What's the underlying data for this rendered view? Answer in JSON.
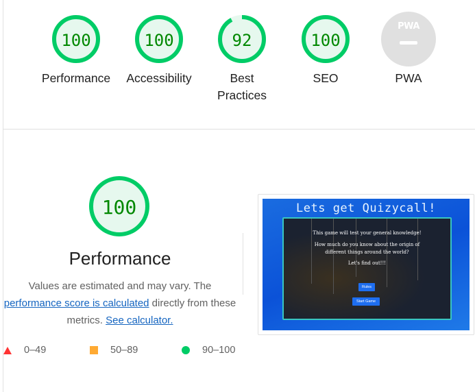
{
  "categories": [
    {
      "label": "Performance",
      "score": "100",
      "value": 100
    },
    {
      "label": "Accessibility",
      "score": "100",
      "value": 100
    },
    {
      "label": "Best Practices",
      "score": "92",
      "value": 92
    },
    {
      "label": "SEO",
      "score": "100",
      "value": 100
    },
    {
      "label": "PWA",
      "logo": "PWA"
    }
  ],
  "performance": {
    "score": "100",
    "title": "Performance",
    "desc_prefix": "Values are estimated and may vary. The ",
    "desc_link": "performance score is calculated",
    "desc_middle": " directly from these metrics. ",
    "desc_calc_link": "See calculator."
  },
  "legend": {
    "fail": "0–49",
    "average": "50–89",
    "pass": "90–100"
  },
  "screenshot": {
    "title": "Lets get Quizycall!",
    "line1": "This game will test your general knowledge!",
    "line2": "How much do you know about the origin of",
    "line3": "different things around the world?",
    "line4": "Let's find out!!!",
    "rules_button": "Rules",
    "start_button": "Start Game"
  },
  "colors": {
    "pass": "#00cc66",
    "pass_fill": "#e6f8ee",
    "pass_text": "#008800",
    "average": "#ffaa33",
    "fail": "#ff3333",
    "link": "#1565c0"
  }
}
